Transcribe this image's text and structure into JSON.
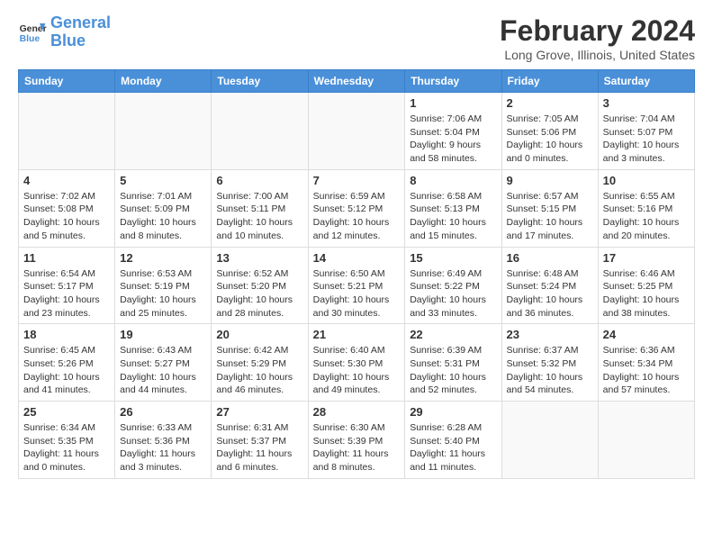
{
  "header": {
    "logo_line1": "General",
    "logo_line2": "Blue",
    "month_title": "February 2024",
    "subtitle": "Long Grove, Illinois, United States"
  },
  "weekdays": [
    "Sunday",
    "Monday",
    "Tuesday",
    "Wednesday",
    "Thursday",
    "Friday",
    "Saturday"
  ],
  "weeks": [
    [
      {
        "day": "",
        "info": ""
      },
      {
        "day": "",
        "info": ""
      },
      {
        "day": "",
        "info": ""
      },
      {
        "day": "",
        "info": ""
      },
      {
        "day": "1",
        "info": "Sunrise: 7:06 AM\nSunset: 5:04 PM\nDaylight: 9 hours and 58 minutes."
      },
      {
        "day": "2",
        "info": "Sunrise: 7:05 AM\nSunset: 5:06 PM\nDaylight: 10 hours and 0 minutes."
      },
      {
        "day": "3",
        "info": "Sunrise: 7:04 AM\nSunset: 5:07 PM\nDaylight: 10 hours and 3 minutes."
      }
    ],
    [
      {
        "day": "4",
        "info": "Sunrise: 7:02 AM\nSunset: 5:08 PM\nDaylight: 10 hours and 5 minutes."
      },
      {
        "day": "5",
        "info": "Sunrise: 7:01 AM\nSunset: 5:09 PM\nDaylight: 10 hours and 8 minutes."
      },
      {
        "day": "6",
        "info": "Sunrise: 7:00 AM\nSunset: 5:11 PM\nDaylight: 10 hours and 10 minutes."
      },
      {
        "day": "7",
        "info": "Sunrise: 6:59 AM\nSunset: 5:12 PM\nDaylight: 10 hours and 12 minutes."
      },
      {
        "day": "8",
        "info": "Sunrise: 6:58 AM\nSunset: 5:13 PM\nDaylight: 10 hours and 15 minutes."
      },
      {
        "day": "9",
        "info": "Sunrise: 6:57 AM\nSunset: 5:15 PM\nDaylight: 10 hours and 17 minutes."
      },
      {
        "day": "10",
        "info": "Sunrise: 6:55 AM\nSunset: 5:16 PM\nDaylight: 10 hours and 20 minutes."
      }
    ],
    [
      {
        "day": "11",
        "info": "Sunrise: 6:54 AM\nSunset: 5:17 PM\nDaylight: 10 hours and 23 minutes."
      },
      {
        "day": "12",
        "info": "Sunrise: 6:53 AM\nSunset: 5:19 PM\nDaylight: 10 hours and 25 minutes."
      },
      {
        "day": "13",
        "info": "Sunrise: 6:52 AM\nSunset: 5:20 PM\nDaylight: 10 hours and 28 minutes."
      },
      {
        "day": "14",
        "info": "Sunrise: 6:50 AM\nSunset: 5:21 PM\nDaylight: 10 hours and 30 minutes."
      },
      {
        "day": "15",
        "info": "Sunrise: 6:49 AM\nSunset: 5:22 PM\nDaylight: 10 hours and 33 minutes."
      },
      {
        "day": "16",
        "info": "Sunrise: 6:48 AM\nSunset: 5:24 PM\nDaylight: 10 hours and 36 minutes."
      },
      {
        "day": "17",
        "info": "Sunrise: 6:46 AM\nSunset: 5:25 PM\nDaylight: 10 hours and 38 minutes."
      }
    ],
    [
      {
        "day": "18",
        "info": "Sunrise: 6:45 AM\nSunset: 5:26 PM\nDaylight: 10 hours and 41 minutes."
      },
      {
        "day": "19",
        "info": "Sunrise: 6:43 AM\nSunset: 5:27 PM\nDaylight: 10 hours and 44 minutes."
      },
      {
        "day": "20",
        "info": "Sunrise: 6:42 AM\nSunset: 5:29 PM\nDaylight: 10 hours and 46 minutes."
      },
      {
        "day": "21",
        "info": "Sunrise: 6:40 AM\nSunset: 5:30 PM\nDaylight: 10 hours and 49 minutes."
      },
      {
        "day": "22",
        "info": "Sunrise: 6:39 AM\nSunset: 5:31 PM\nDaylight: 10 hours and 52 minutes."
      },
      {
        "day": "23",
        "info": "Sunrise: 6:37 AM\nSunset: 5:32 PM\nDaylight: 10 hours and 54 minutes."
      },
      {
        "day": "24",
        "info": "Sunrise: 6:36 AM\nSunset: 5:34 PM\nDaylight: 10 hours and 57 minutes."
      }
    ],
    [
      {
        "day": "25",
        "info": "Sunrise: 6:34 AM\nSunset: 5:35 PM\nDaylight: 11 hours and 0 minutes."
      },
      {
        "day": "26",
        "info": "Sunrise: 6:33 AM\nSunset: 5:36 PM\nDaylight: 11 hours and 3 minutes."
      },
      {
        "day": "27",
        "info": "Sunrise: 6:31 AM\nSunset: 5:37 PM\nDaylight: 11 hours and 6 minutes."
      },
      {
        "day": "28",
        "info": "Sunrise: 6:30 AM\nSunset: 5:39 PM\nDaylight: 11 hours and 8 minutes."
      },
      {
        "day": "29",
        "info": "Sunrise: 6:28 AM\nSunset: 5:40 PM\nDaylight: 11 hours and 11 minutes."
      },
      {
        "day": "",
        "info": ""
      },
      {
        "day": "",
        "info": ""
      }
    ]
  ]
}
